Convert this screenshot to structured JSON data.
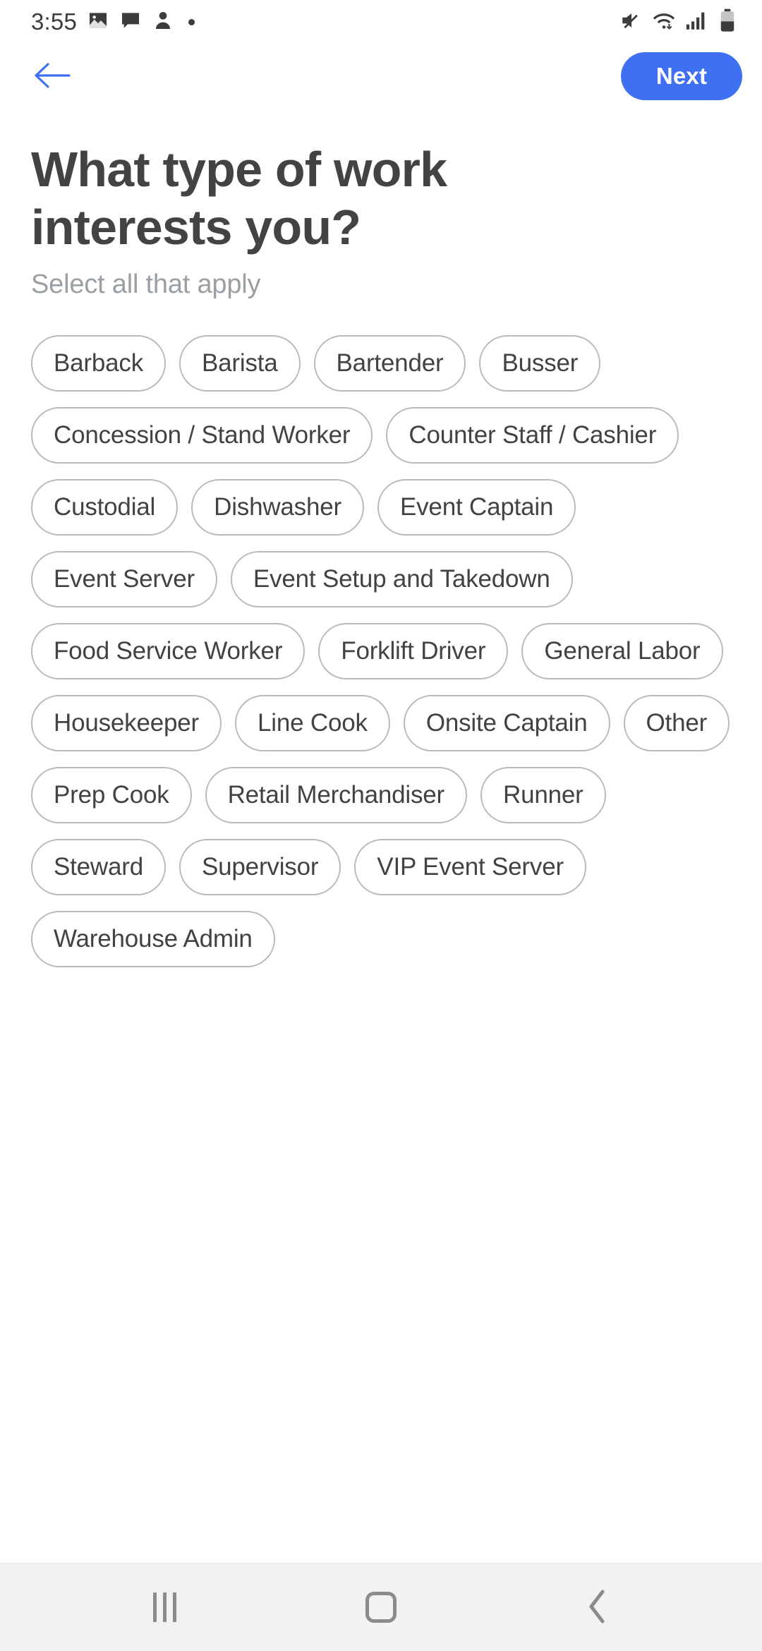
{
  "status_bar": {
    "time": "3:55",
    "left_icons": [
      "photo-icon",
      "chat-bubble-icon",
      "person-icon",
      "notification-dot"
    ],
    "right_icons": [
      "mute-icon",
      "wifi-icon",
      "cellular-signal-icon",
      "battery-icon"
    ],
    "icon_color": "#3c3c3c"
  },
  "top_bar": {
    "back_icon": "arrow-left-icon",
    "back_color": "#4070f2",
    "next_label": "Next",
    "next_bg": "#4070f2",
    "next_text_color": "#ffffff"
  },
  "page": {
    "title": "What type of work interests you?",
    "subtitle": "Select all that apply",
    "title_color": "#434343",
    "subtitle_color": "#9a9fa3"
  },
  "chips": {
    "border_color": "#b6bbbe",
    "text_color": "#3f4346",
    "selected": [],
    "items": [
      "Barback",
      "Barista",
      "Bartender",
      "Busser",
      "Concession / Stand Worker",
      "Counter Staff / Cashier",
      "Custodial",
      "Dishwasher",
      "Event Captain",
      "Event Server",
      "Event Setup and Takedown",
      "Food Service Worker",
      "Forklift Driver",
      "General Labor",
      "Housekeeper",
      "Line Cook",
      "Onsite Captain",
      "Other",
      "Prep Cook",
      "Retail Merchandiser",
      "Runner",
      "Steward",
      "Supervisor",
      "VIP Event Server",
      "Warehouse Admin"
    ]
  },
  "nav_bar": {
    "background": "#f2f2f2",
    "icon_color": "#8b8b8b",
    "buttons": [
      "recents-icon",
      "home-icon",
      "back-chevron-icon"
    ]
  }
}
